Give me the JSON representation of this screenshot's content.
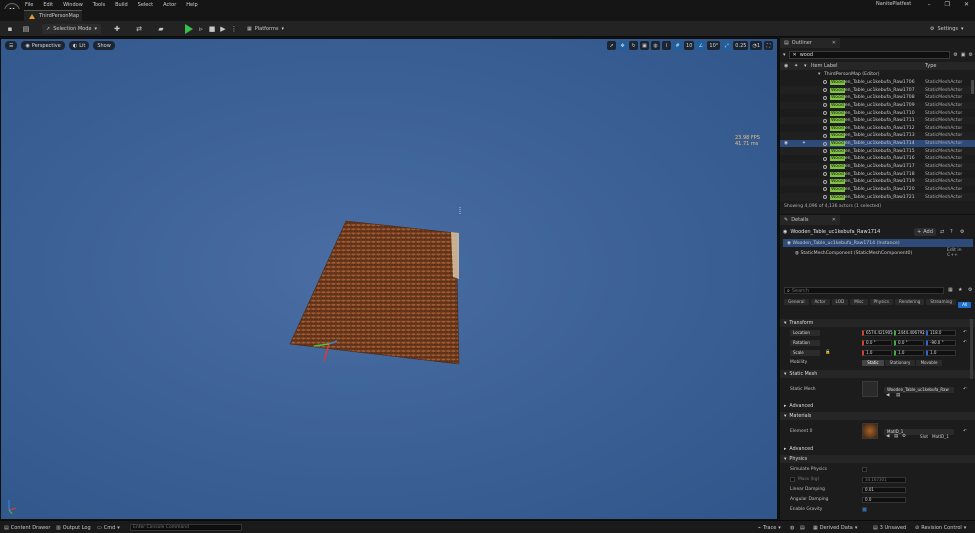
{
  "menu": {
    "logo": "U",
    "items": [
      "File",
      "Edit",
      "Window",
      "Tools",
      "Build",
      "Select",
      "Actor",
      "Help"
    ],
    "project_name": "NanitePlatfest",
    "window_controls": [
      "–",
      "❐",
      "✕"
    ]
  },
  "tab": {
    "map_name": "ThirdPersonMap"
  },
  "toolbar": {
    "selection_mode": "Selection Mode",
    "platforms": "Platforms",
    "settings": "Settings"
  },
  "viewport": {
    "perspective": "Perspective",
    "lit": "Lit",
    "show": "Show",
    "grid_snap": "10",
    "angle_snap": "10°",
    "scale_snap": "0.25",
    "camera_speed": "1",
    "fps_line1": "23.98 FPS",
    "fps_line2": "41.71 ms"
  },
  "outliner": {
    "tab_label": "Outliner",
    "search_value": "wood",
    "col_item_label": "Item Label",
    "col_type": "Type",
    "root_item": "ThirdPersonMap (Editor)",
    "rows": [
      {
        "prefix": "Wood",
        "rest": "en_Table_uc1kebufa_Raw1706",
        "type": "StaticMeshActor"
      },
      {
        "prefix": "Wood",
        "rest": "en_Table_uc1kebufa_Raw1707",
        "type": "StaticMeshActor"
      },
      {
        "prefix": "Wood",
        "rest": "en_Table_uc1kebufa_Raw1708",
        "type": "StaticMeshActor"
      },
      {
        "prefix": "Wood",
        "rest": "en_Table_uc1kebufa_Raw1709",
        "type": "StaticMeshActor"
      },
      {
        "prefix": "Wood",
        "rest": "en_Table_uc1kebufa_Raw1710",
        "type": "StaticMeshActor"
      },
      {
        "prefix": "Wood",
        "rest": "en_Table_uc1kebufa_Raw1711",
        "type": "StaticMeshActor"
      },
      {
        "prefix": "Wood",
        "rest": "en_Table_uc1kebufa_Raw1712",
        "type": "StaticMeshActor"
      },
      {
        "prefix": "Wood",
        "rest": "en_Table_uc1kebufa_Raw1713",
        "type": "StaticMeshActor"
      },
      {
        "prefix": "Wood",
        "rest": "en_Table_uc1kebufa_Raw1714",
        "type": "StaticMeshActor"
      },
      {
        "prefix": "Wood",
        "rest": "en_Table_uc1kebufa_Raw1715",
        "type": "StaticMeshActor"
      },
      {
        "prefix": "Wood",
        "rest": "en_Table_uc1kebufa_Raw1716",
        "type": "StaticMeshActor"
      },
      {
        "prefix": "Wood",
        "rest": "en_Table_uc1kebufa_Raw1717",
        "type": "StaticMeshActor"
      },
      {
        "prefix": "Wood",
        "rest": "en_Table_uc1kebufa_Raw1718",
        "type": "StaticMeshActor"
      },
      {
        "prefix": "Wood",
        "rest": "en_Table_uc1kebufa_Raw1719",
        "type": "StaticMeshActor"
      },
      {
        "prefix": "Wood",
        "rest": "en_Table_uc1kebufa_Raw1720",
        "type": "StaticMeshActor"
      },
      {
        "prefix": "Wood",
        "rest": "en_Table_uc1kebufa_Raw1721",
        "type": "StaticMeshActor"
      }
    ],
    "selected_row": 8,
    "footer": "Showing 4,096 of 4,136 actors (1 selected)"
  },
  "details": {
    "tab_label": "Details",
    "actor_name": "Wooden_Table_uc1kebufa_Raw1714",
    "add_label": "Add",
    "instance_row": "Wooden_Table_uc1kebufa_Raw1714 (Instance)",
    "component_row": "StaticMeshComponent (StaticMeshComponent0)",
    "edit_in_cpp": "Edit in C++",
    "search_placeholder": "Search",
    "filter_tabs": [
      "General",
      "Actor",
      "LOD",
      "Misc",
      "Physics",
      "Rendering",
      "Streaming"
    ],
    "filter_all": "All",
    "transform": {
      "section": "Transform",
      "location_label": "Location",
      "location": [
        "6574.421905",
        "2444.406792",
        "118.0"
      ],
      "rotation_label": "Rotation",
      "rotation": [
        "0.0 °",
        "0.0 °",
        "-90.0 °"
      ],
      "scale_label": "Scale",
      "scale": [
        "1.0",
        "1.0",
        "1.0"
      ],
      "mobility_label": "Mobility",
      "mobility": [
        "Static",
        "Stationary",
        "Movable"
      ]
    },
    "static_mesh": {
      "section": "Static Mesh",
      "label": "Static Mesh",
      "value": "Wooden_Table_uc1kebufa_Raw"
    },
    "advanced": "Advanced",
    "materials": {
      "section": "Materials",
      "label": "Element 0",
      "value": "MatID_1",
      "slot_label": "Slot",
      "slot_value": "MatID_1"
    },
    "physics": {
      "section": "Physics",
      "simulate": "Simulate Physics",
      "mass": "Mass (kg)",
      "mass_value": "34.167301",
      "linear_damping": "Linear Damping",
      "linear_value": "0.01",
      "angular_damping": "Angular Damping",
      "angular_value": "0.0",
      "gravity": "Enable Gravity"
    }
  },
  "statusbar": {
    "content_drawer": "Content Drawer",
    "output_log": "Output Log",
    "cmd": "Cmd",
    "console_placeholder": "Enter Console Command",
    "trace": "Trace",
    "derived_data": "Derived Data",
    "unsaved": "3 Unsaved",
    "revision_control": "Revision Control"
  },
  "colors": {
    "viewport_blue": "#3d6298",
    "play_green": "#39c04a",
    "selection_blue": "#2e4a78",
    "search_highlight": "#7fc244"
  }
}
